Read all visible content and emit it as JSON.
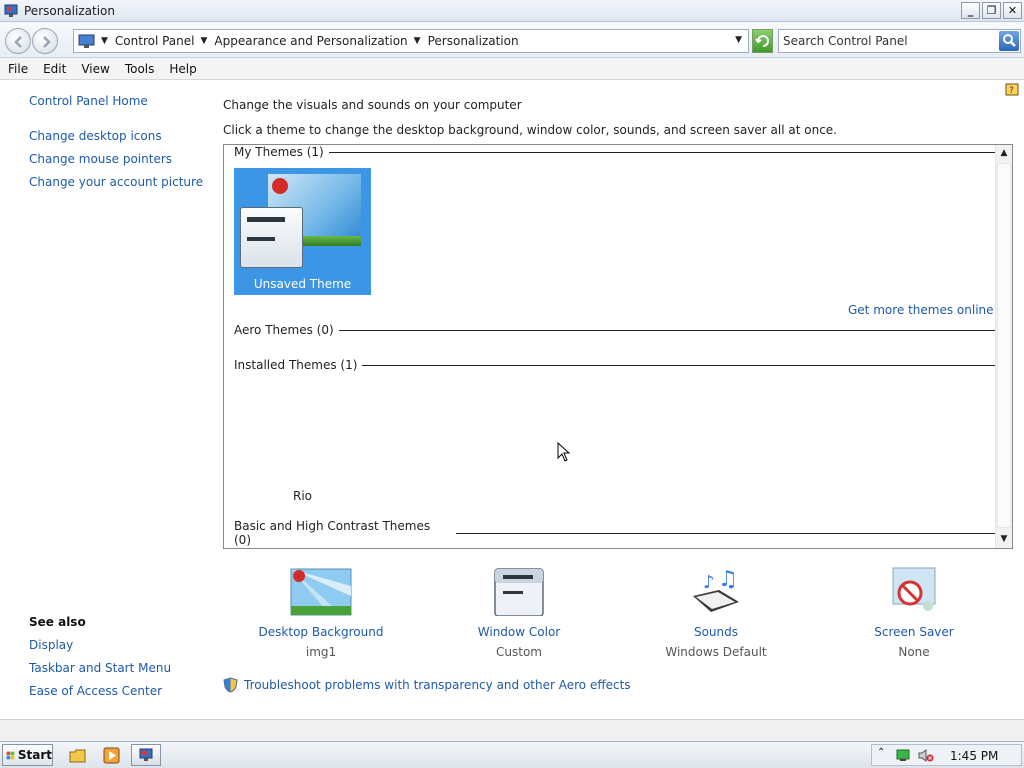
{
  "window": {
    "title": "Personalization",
    "minimize": "_",
    "maximize": "❐",
    "close": "✕"
  },
  "address": {
    "crumbs": [
      "Control Panel",
      "Appearance and Personalization",
      "Personalization"
    ],
    "search_placeholder": "Search Control Panel"
  },
  "menu": [
    "File",
    "Edit",
    "View",
    "Tools",
    "Help"
  ],
  "sidebar": {
    "home": "Control Panel Home",
    "links": [
      "Change desktop icons",
      "Change mouse pointers",
      "Change your account picture"
    ],
    "see_also_title": "See also",
    "see_also": [
      "Display",
      "Taskbar and Start Menu",
      "Ease of Access Center"
    ]
  },
  "main": {
    "heading": "Change the visuals and sounds on your computer",
    "subheading": "Click a theme to change the desktop background, window color, sounds, and screen saver all at once.",
    "groups": {
      "my_themes": "My Themes (1)",
      "aero_themes": "Aero Themes (0)",
      "installed_themes": "Installed Themes (1)",
      "basic_themes": "Basic and High Contrast Themes (0)"
    },
    "selected_theme": "Unsaved Theme",
    "get_more": "Get more themes online",
    "installed_theme_name": "Rio"
  },
  "settings": [
    {
      "label": "Desktop Background",
      "value": "img1",
      "icon": "desktop-background-icon"
    },
    {
      "label": "Window Color",
      "value": "Custom",
      "icon": "window-color-icon"
    },
    {
      "label": "Sounds",
      "value": "Windows Default",
      "icon": "sounds-icon"
    },
    {
      "label": "Screen Saver",
      "value": "None",
      "icon": "screen-saver-icon"
    }
  ],
  "troubleshoot": "Troubleshoot problems with transparency and other Aero effects",
  "taskbar": {
    "start": "Start",
    "clock": "1:45 PM"
  },
  "colors": {
    "link": "#1e5aa8",
    "selection": "#3d95e6"
  }
}
